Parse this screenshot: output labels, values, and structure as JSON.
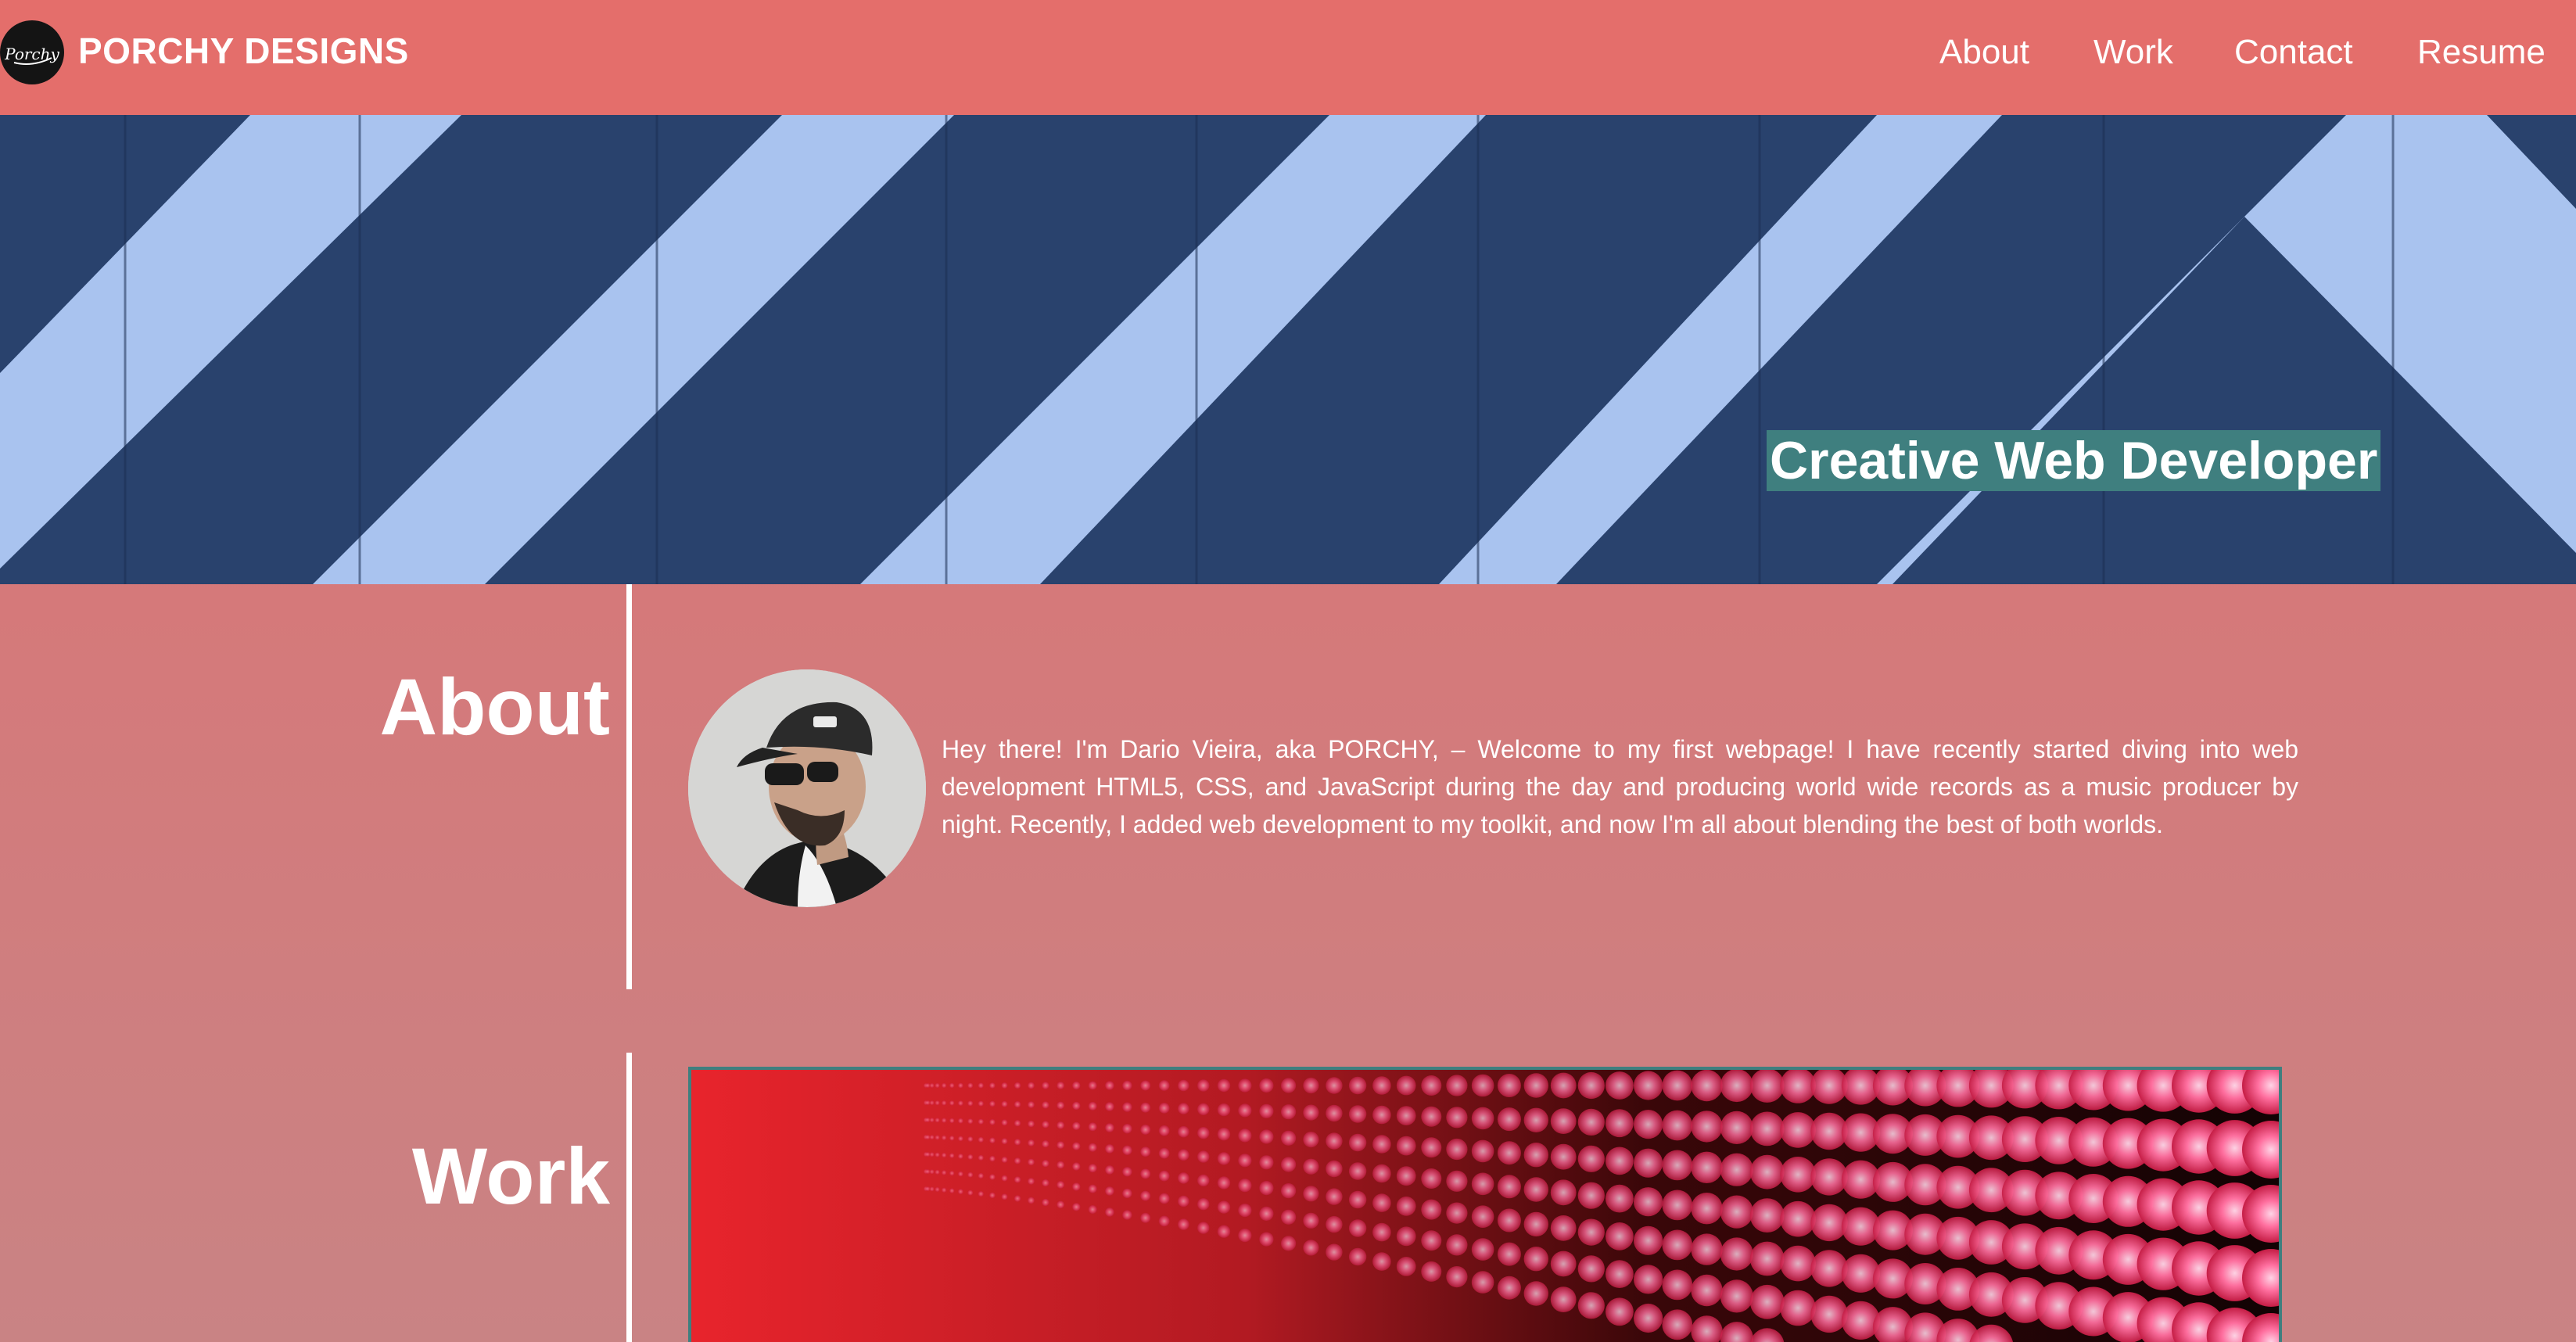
{
  "nav": {
    "brand": "PORCHY DESIGNS",
    "logo_text": "Porchy",
    "links": [
      "About",
      "Work",
      "Contact",
      "Resume"
    ]
  },
  "hero": {
    "tagline": "Creative Web Developer"
  },
  "about": {
    "title": "About",
    "text": "Hey there! I'm Dario Vieira, aka PORCHY, – Welcome to my first webpage! I have recently started diving into web development HTML5, CSS, and JavaScript during the day and producing world wide records as a music producer by night. Recently, I added web development to my toolkit, and now I'm all about blending the best of both worlds."
  },
  "work": {
    "title": "Work"
  },
  "colors": {
    "nav_bg": "#e46e6b",
    "accent": "#3f7f7f",
    "stripe_dark": "#29426d",
    "stripe_light": "#a9c3ef"
  }
}
